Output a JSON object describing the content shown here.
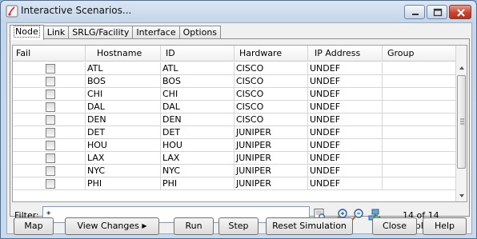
{
  "window": {
    "title": "Interactive Scenarios..."
  },
  "tabs": [
    "Node",
    "Link",
    "SRLG/Facility",
    "Interface",
    "Options"
  ],
  "table": {
    "columns": [
      "Fail",
      "Hostname",
      "ID",
      "Hardware",
      "IP Address",
      "Group"
    ],
    "rows": [
      {
        "host": "ATL",
        "id": "ATL",
        "hw": "CISCO",
        "ip": "UNDEF",
        "group": ""
      },
      {
        "host": "BOS",
        "id": "BOS",
        "hw": "CISCO",
        "ip": "UNDEF",
        "group": ""
      },
      {
        "host": "CHI",
        "id": "CHI",
        "hw": "CISCO",
        "ip": "UNDEF",
        "group": ""
      },
      {
        "host": "DAL",
        "id": "DAL",
        "hw": "CISCO",
        "ip": "UNDEF",
        "group": ""
      },
      {
        "host": "DEN",
        "id": "DEN",
        "hw": "CISCO",
        "ip": "UNDEF",
        "group": ""
      },
      {
        "host": "DET",
        "id": "DET",
        "hw": "JUNIPER",
        "ip": "UNDEF",
        "group": ""
      },
      {
        "host": "HOU",
        "id": "HOU",
        "hw": "JUNIPER",
        "ip": "UNDEF",
        "group": ""
      },
      {
        "host": "LAX",
        "id": "LAX",
        "hw": "JUNIPER",
        "ip": "UNDEF",
        "group": ""
      },
      {
        "host": "NYC",
        "id": "NYC",
        "hw": "JUNIPER",
        "ip": "UNDEF",
        "group": ""
      },
      {
        "host": "PHI",
        "id": "PHI",
        "hw": "JUNIPER",
        "ip": "UNDEF",
        "group": ""
      }
    ]
  },
  "filter": {
    "label": "Filter:",
    "value": "*",
    "displayed": "14 of 14 displayed"
  },
  "buttons": {
    "map": "Map",
    "view_changes": "View Changes",
    "run": "Run",
    "step": "Step",
    "reset": "Reset Simulation",
    "close": "Close",
    "help": "Help"
  }
}
